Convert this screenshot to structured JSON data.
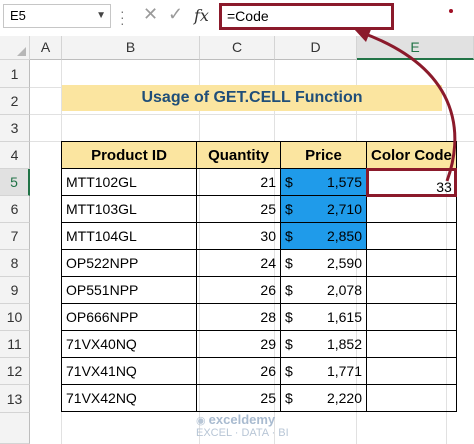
{
  "formula_bar": {
    "name_box": "E5",
    "cancel_icon": "✕",
    "enter_icon": "✓",
    "fx_label": "fx",
    "formula": "=Code"
  },
  "columns": [
    "A",
    "B",
    "C",
    "D",
    "E"
  ],
  "rows": [
    "1",
    "2",
    "3",
    "4",
    "5",
    "6",
    "7",
    "8",
    "9",
    "10",
    "11",
    "12",
    "13"
  ],
  "sheet": {
    "title": "Usage of GET.CELL Function",
    "headers": [
      "Product ID",
      "Quantity",
      "Price",
      "Color Code"
    ],
    "currency_symbol": "$",
    "records": [
      {
        "product": "MTT102GL",
        "quantity": "21",
        "price": "1,575",
        "color_code": "33",
        "highlight": true
      },
      {
        "product": "MTT103GL",
        "quantity": "25",
        "price": "2,710",
        "color_code": "",
        "highlight": true
      },
      {
        "product": "MTT104GL",
        "quantity": "30",
        "price": "2,850",
        "color_code": "",
        "highlight": true
      },
      {
        "product": "OP522NPP",
        "quantity": "24",
        "price": "2,590",
        "color_code": "",
        "highlight": false
      },
      {
        "product": "OP551NPP",
        "quantity": "26",
        "price": "2,078",
        "color_code": "",
        "highlight": false
      },
      {
        "product": "OP666NPP",
        "quantity": "28",
        "price": "1,615",
        "color_code": "",
        "highlight": false
      },
      {
        "product": "71VX40NQ",
        "quantity": "29",
        "price": "1,852",
        "color_code": "",
        "highlight": false
      },
      {
        "product": "71VX41NQ",
        "quantity": "26",
        "price": "1,771",
        "color_code": "",
        "highlight": false
      },
      {
        "product": "71VX42NQ",
        "quantity": "25",
        "price": "2,220",
        "color_code": "",
        "highlight": false
      }
    ]
  },
  "selected_cell": "E5",
  "watermark": {
    "brand": "exceldemy",
    "tagline": "EXCEL · DATA · BI"
  },
  "colors": {
    "accent": "#8b1a2b",
    "highlight_fill": "#1f9bea",
    "header_fill": "#fbe5a0",
    "title_text": "#1f4e79"
  }
}
